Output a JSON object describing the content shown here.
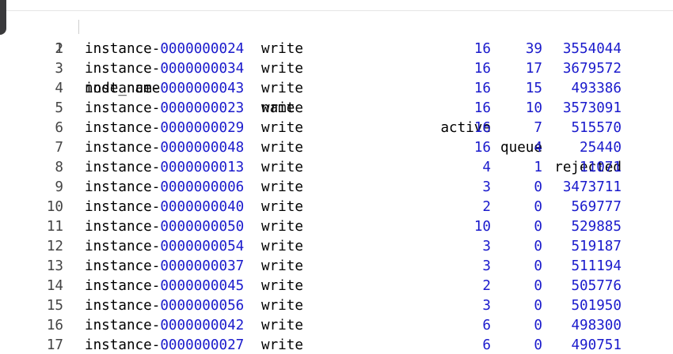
{
  "colors": {
    "text": "#000000",
    "number": "#1a1acc",
    "line_number": "#444444"
  },
  "header": {
    "line": "1",
    "node_name": "node_name",
    "name": "name",
    "active": "active",
    "queue": "queue",
    "rejected": "rejected"
  },
  "rows": [
    {
      "line": "2",
      "prefix": "instance-",
      "id": "0000000024",
      "name": "write",
      "active": "16",
      "queue": "39",
      "rejected": "3554044"
    },
    {
      "line": "3",
      "prefix": "instance-",
      "id": "0000000034",
      "name": "write",
      "active": "16",
      "queue": "17",
      "rejected": "3679572"
    },
    {
      "line": "4",
      "prefix": "instance-",
      "id": "0000000043",
      "name": "write",
      "active": "16",
      "queue": "15",
      "rejected": "493386"
    },
    {
      "line": "5",
      "prefix": "instance-",
      "id": "0000000023",
      "name": "write",
      "active": "16",
      "queue": "10",
      "rejected": "3573091"
    },
    {
      "line": "6",
      "prefix": "instance-",
      "id": "0000000029",
      "name": "write",
      "active": "16",
      "queue": "7",
      "rejected": "515570"
    },
    {
      "line": "7",
      "prefix": "instance-",
      "id": "0000000048",
      "name": "write",
      "active": "16",
      "queue": "4",
      "rejected": "25440"
    },
    {
      "line": "8",
      "prefix": "instance-",
      "id": "0000000013",
      "name": "write",
      "active": "4",
      "queue": "1",
      "rejected": "11071"
    },
    {
      "line": "9",
      "prefix": "instance-",
      "id": "0000000006",
      "name": "write",
      "active": "3",
      "queue": "0",
      "rejected": "3473711"
    },
    {
      "line": "10",
      "prefix": "instance-",
      "id": "0000000040",
      "name": "write",
      "active": "2",
      "queue": "0",
      "rejected": "569777"
    },
    {
      "line": "11",
      "prefix": "instance-",
      "id": "0000000050",
      "name": "write",
      "active": "10",
      "queue": "0",
      "rejected": "529885"
    },
    {
      "line": "12",
      "prefix": "instance-",
      "id": "0000000054",
      "name": "write",
      "active": "3",
      "queue": "0",
      "rejected": "519187"
    },
    {
      "line": "13",
      "prefix": "instance-",
      "id": "0000000037",
      "name": "write",
      "active": "3",
      "queue": "0",
      "rejected": "511194"
    },
    {
      "line": "14",
      "prefix": "instance-",
      "id": "0000000045",
      "name": "write",
      "active": "2",
      "queue": "0",
      "rejected": "505776"
    },
    {
      "line": "15",
      "prefix": "instance-",
      "id": "0000000056",
      "name": "write",
      "active": "3",
      "queue": "0",
      "rejected": "501950"
    },
    {
      "line": "16",
      "prefix": "instance-",
      "id": "0000000042",
      "name": "write",
      "active": "6",
      "queue": "0",
      "rejected": "498300"
    },
    {
      "line": "17",
      "prefix": "instance-",
      "id": "0000000027",
      "name": "write",
      "active": "6",
      "queue": "0",
      "rejected": "490751"
    }
  ]
}
